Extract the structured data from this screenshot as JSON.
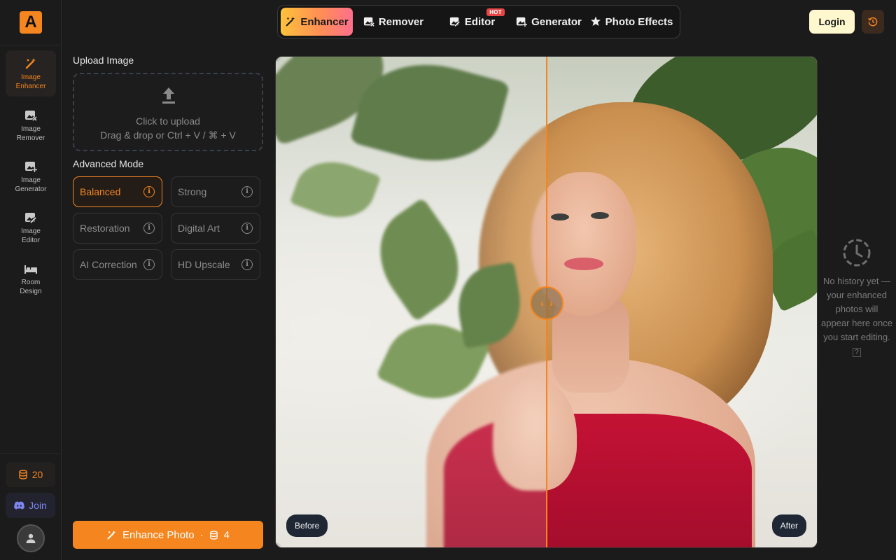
{
  "brand": {
    "logo_letter": "A",
    "accent": "#f5861f"
  },
  "sidebar": {
    "items": [
      {
        "line1": "Image",
        "line2": "Enhancer",
        "icon": "magic-wand-icon",
        "active": true
      },
      {
        "line1": "Image",
        "line2": "Remover",
        "icon": "image-remove-icon",
        "active": false
      },
      {
        "line1": "Image",
        "line2": "Generator",
        "icon": "image-add-icon",
        "active": false
      },
      {
        "line1": "Image",
        "line2": "Editor",
        "icon": "image-edit-icon",
        "active": false
      },
      {
        "line1": "Room",
        "line2": "Design",
        "icon": "bed-icon",
        "active": false
      }
    ],
    "credits": "20",
    "join_label": "Join"
  },
  "topnav": {
    "tabs": [
      {
        "label": "Enhancer",
        "icon": "magic-wand-icon",
        "active": true
      },
      {
        "label": "Remover",
        "icon": "image-remove-icon",
        "active": false
      },
      {
        "label": "Editor",
        "icon": "image-edit-icon",
        "active": false,
        "badge": "HOT"
      },
      {
        "label": "Generator",
        "icon": "image-add-icon",
        "active": false
      },
      {
        "label": "Photo Effects",
        "icon": "sparkle-icon",
        "active": false
      }
    ],
    "login_label": "Login",
    "history_icon": "history-icon"
  },
  "panel": {
    "upload_title": "Upload Image",
    "upload_line1": "Click to upload",
    "upload_line2": "Drag & drop or Ctrl + V / ⌘ + V",
    "mode_title": "Advanced Mode",
    "modes": [
      {
        "label": "Balanced",
        "active": true
      },
      {
        "label": "Strong",
        "active": false
      },
      {
        "label": "Restoration",
        "active": false
      },
      {
        "label": "Digital Art",
        "active": false
      },
      {
        "label": "AI Correction",
        "active": false
      },
      {
        "label": "HD Upscale",
        "active": false
      }
    ],
    "enhance_label": "Enhance Photo",
    "enhance_separator": "·",
    "enhance_cost": "4"
  },
  "canvas": {
    "before_label": "Before",
    "after_label": "After",
    "split_fraction": 0.5
  },
  "history": {
    "empty_text": "No history yet — your enhanced photos will appear here once you start editing.",
    "empty_suffix": "?"
  }
}
